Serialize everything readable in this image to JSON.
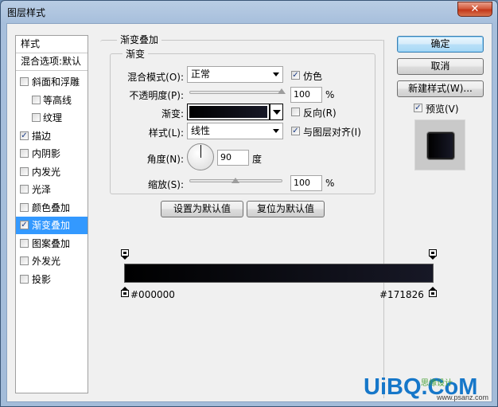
{
  "window": {
    "title": "图层样式",
    "close_glyph": "✕"
  },
  "style_list": {
    "header": "样式",
    "blend": "混合选项:默认",
    "items": [
      {
        "label": "斜面和浮雕",
        "checked": false,
        "sub": false,
        "selected": false
      },
      {
        "label": "等高线",
        "checked": false,
        "sub": true,
        "selected": false
      },
      {
        "label": "纹理",
        "checked": false,
        "sub": true,
        "selected": false
      },
      {
        "label": "描边",
        "checked": true,
        "sub": false,
        "selected": false
      },
      {
        "label": "内阴影",
        "checked": false,
        "sub": false,
        "selected": false
      },
      {
        "label": "内发光",
        "checked": false,
        "sub": false,
        "selected": false
      },
      {
        "label": "光泽",
        "checked": false,
        "sub": false,
        "selected": false
      },
      {
        "label": "颜色叠加",
        "checked": false,
        "sub": false,
        "selected": false
      },
      {
        "label": "渐变叠加",
        "checked": true,
        "sub": false,
        "selected": true
      },
      {
        "label": "图案叠加",
        "checked": false,
        "sub": false,
        "selected": false
      },
      {
        "label": "外发光",
        "checked": false,
        "sub": false,
        "selected": false
      },
      {
        "label": "投影",
        "checked": false,
        "sub": false,
        "selected": false
      }
    ]
  },
  "panel": {
    "title": "渐变叠加",
    "subgroup": "渐变",
    "blend_mode_label": "混合模式(O):",
    "blend_mode_value": "正常",
    "dither_label": "仿色",
    "dither_checked": true,
    "opacity_label": "不透明度(P):",
    "opacity_value": "100",
    "opacity_fraction": 1.0,
    "percent": "%",
    "gradient_label": "渐变:",
    "reverse_label": "反向(R)",
    "reverse_checked": false,
    "style_label": "样式(L):",
    "style_value": "线性",
    "align_label": "与图层对齐(I)",
    "align_checked": true,
    "angle_label": "角度(N):",
    "angle_value": "90",
    "angle_unit": "度",
    "scale_label": "缩放(S):",
    "scale_value": "100",
    "scale_fraction": 0.5,
    "set_default": "设置为默认值",
    "reset_default": "复位为默认值"
  },
  "right": {
    "ok": "确定",
    "cancel": "取消",
    "new_style": "新建样式(W)...",
    "preview_label": "预览(V)",
    "preview_checked": true
  },
  "gradient_editor": {
    "left_color": "#000000",
    "right_color": "#171826"
  },
  "watermark": {
    "main": "UiBQ.CoM",
    "sub": "www.psanz.com",
    "mid": "思缘设计"
  },
  "colors": {
    "selected": "#3399ff",
    "default_button_border": "#3c7fb1"
  }
}
